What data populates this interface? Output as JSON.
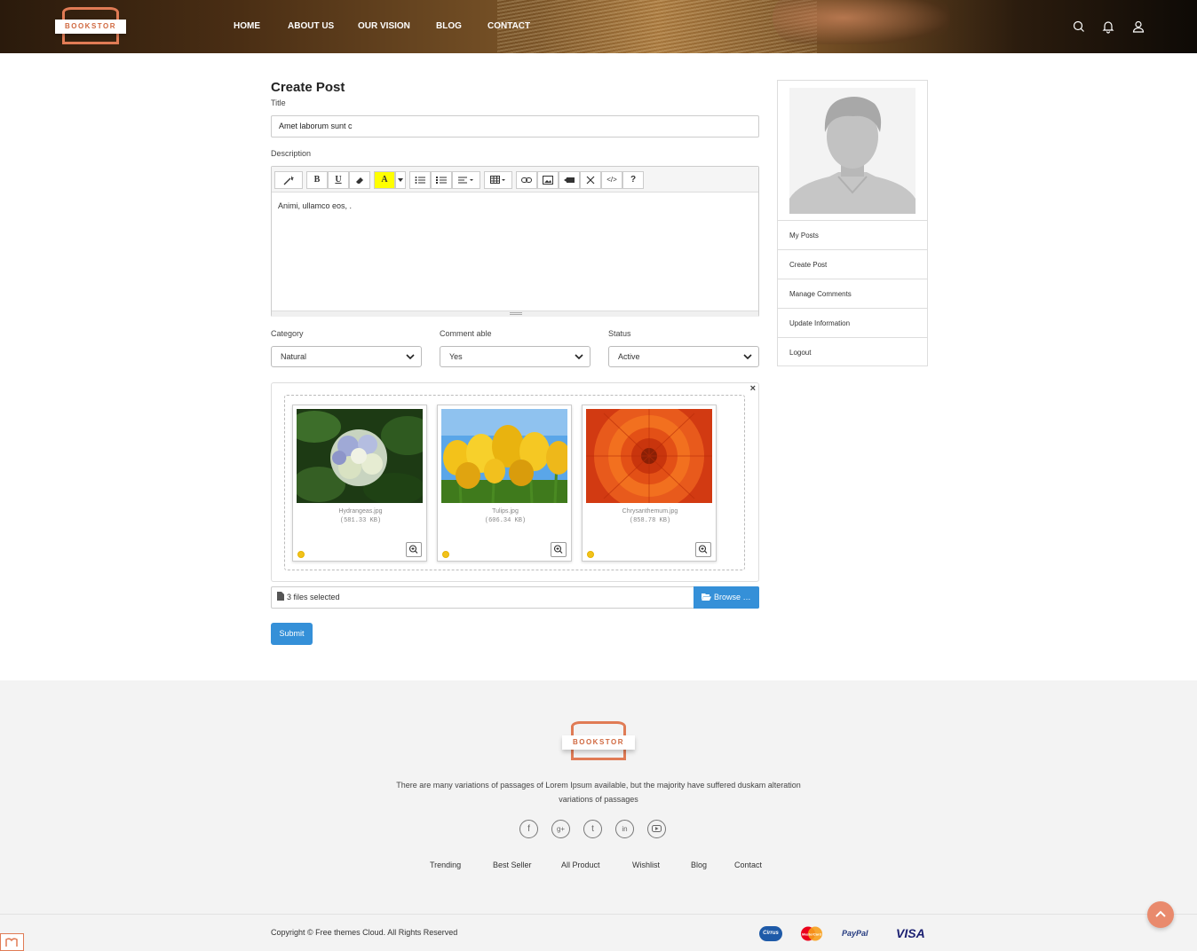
{
  "header": {
    "logo_text": "BOOKSTOR",
    "nav": [
      "HOME",
      "ABOUT US",
      "OUR VISION",
      "BLOG",
      "CONTACT"
    ]
  },
  "form": {
    "heading": "Create Post",
    "title_label": "Title",
    "title_value": "Amet laborum sunt c",
    "description_label": "Description",
    "description_value": "Animi, ullamco eos, .",
    "category_label": "Category",
    "category_value": "Natural",
    "commentable_label": "Comment able",
    "commentable_value": "Yes",
    "status_label": "Status",
    "status_value": "Active",
    "close_glyph": "×",
    "files": [
      {
        "name": "Hydrangeas.jpg",
        "size": "(581.33 KB)"
      },
      {
        "name": "Tulips.jpg",
        "size": "(606.34 KB)"
      },
      {
        "name": "Chrysanthemum.jpg",
        "size": "(858.78 KB)"
      }
    ],
    "files_caption": "3 files selected",
    "browse_label": "Browse …",
    "submit_label": "Submit"
  },
  "toolbar": {
    "bold": "B",
    "underline": "U",
    "color": "A",
    "help": "?",
    "code": "</>"
  },
  "sidebar": {
    "items": [
      "My Posts",
      "Create Post",
      "Manage Comments",
      "Update Information",
      "Logout"
    ]
  },
  "footer": {
    "logo_text": "BOOKSTOR",
    "text": "There are many variations of passages of Lorem Ipsum available, but the majority have suffered duskam alteration variations of passages",
    "links": [
      "Trending",
      "Best Seller",
      "All Product",
      "Wishlist",
      "Blog",
      "Contact"
    ],
    "copyright": "Copyright © Free themes Cloud. All Rights Reserved",
    "payments": [
      "Cirrus",
      "MasterCard",
      "PayPal",
      "VISA"
    ]
  },
  "colors": {
    "accent": "#3590d8",
    "brand": "#e07b55"
  }
}
